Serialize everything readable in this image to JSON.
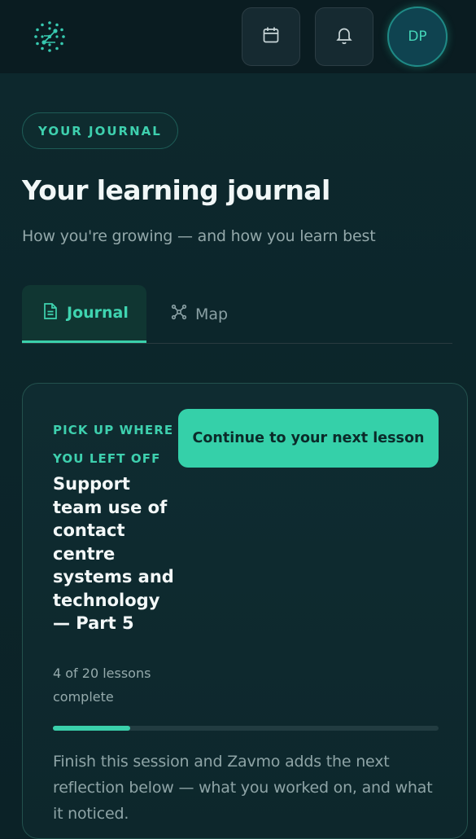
{
  "header": {
    "logo_icon": "constellation-logo-icon",
    "calendar_icon": "calendar-icon",
    "bell_icon": "bell-icon",
    "avatar_initials": "DP"
  },
  "page": {
    "eyebrow": "YOUR JOURNAL",
    "title": "Your learning journal",
    "subtitle": "How you're growing — and how you learn best"
  },
  "tabs": [
    {
      "label": "Journal",
      "icon": "document-icon",
      "active": true
    },
    {
      "label": "Map",
      "icon": "network-icon",
      "active": false
    }
  ],
  "resume_card": {
    "kicker": "PICK UP WHERE YOU LEFT OFF",
    "course_title": "Support team use of contact centre systems and technology — Part 5",
    "progress_text": "4 of 20 lessons complete",
    "lessons_done": 4,
    "lessons_total": 20,
    "cta_label": "Continue to your next lesson",
    "note": "Finish this session and Zavmo adds the next reflection below — what you worked on, and what it noticed."
  },
  "colors": {
    "accent": "#35d0a9",
    "background": "#0b2227",
    "topbar": "#0a1c21"
  }
}
